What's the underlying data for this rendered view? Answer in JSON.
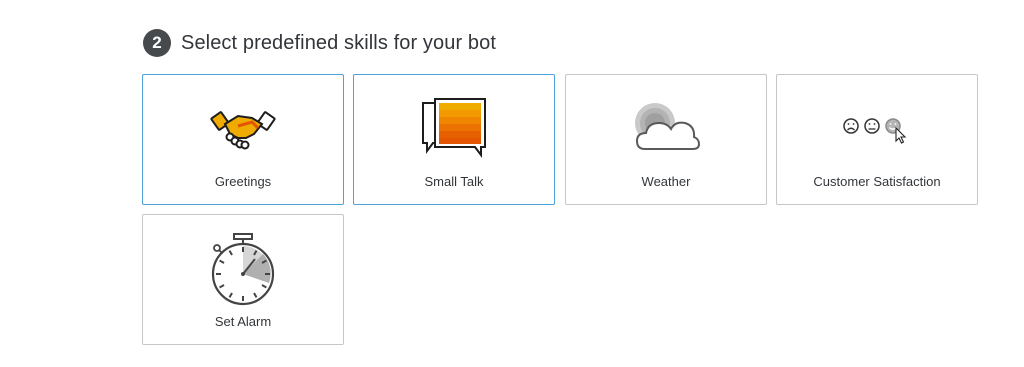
{
  "section": {
    "step_number": "2",
    "title": "Select predefined skills for your bot"
  },
  "skills": [
    {
      "label": "Greetings",
      "icon": "handshake-icon",
      "selected": true
    },
    {
      "label": "Small Talk",
      "icon": "chat-bubbles-icon",
      "selected": true
    },
    {
      "label": "Weather",
      "icon": "cloud-sun-icon",
      "selected": false
    },
    {
      "label": "Customer Satisfaction",
      "icon": "smiley-faces-icon",
      "selected": false
    },
    {
      "label": "Set Alarm",
      "icon": "stopwatch-icon",
      "selected": false
    }
  ],
  "colors": {
    "selected_border": "#4fa1d9",
    "default_border": "#c6c6c6",
    "accent_orange": "#f0ab00",
    "accent_orange_dark": "#e35500",
    "badge": "#474a4d"
  }
}
